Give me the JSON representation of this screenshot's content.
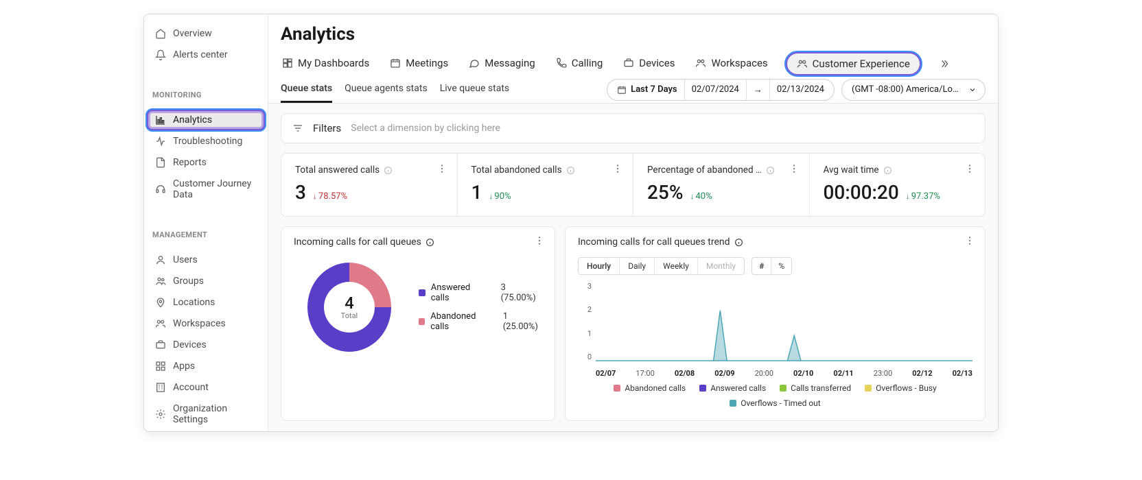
{
  "sidebar": {
    "top": [
      {
        "name": "overview",
        "label": "Overview"
      },
      {
        "name": "alerts-center",
        "label": "Alerts center"
      }
    ],
    "monitoring_label": "MONITORING",
    "monitoring": [
      {
        "name": "analytics",
        "label": "Analytics",
        "active": true
      },
      {
        "name": "troubleshooting",
        "label": "Troubleshooting"
      },
      {
        "name": "reports",
        "label": "Reports"
      },
      {
        "name": "customer-journey",
        "label": "Customer Journey Data"
      }
    ],
    "management_label": "MANAGEMENT",
    "management": [
      {
        "name": "users",
        "label": "Users"
      },
      {
        "name": "groups",
        "label": "Groups"
      },
      {
        "name": "locations",
        "label": "Locations"
      },
      {
        "name": "workspaces",
        "label": "Workspaces"
      },
      {
        "name": "devices",
        "label": "Devices"
      },
      {
        "name": "apps",
        "label": "Apps"
      },
      {
        "name": "account",
        "label": "Account"
      },
      {
        "name": "organization-settings",
        "label": "Organization Settings"
      }
    ]
  },
  "header": {
    "title": "Analytics",
    "tabs": [
      {
        "name": "my-dashboards",
        "label": "My Dashboards"
      },
      {
        "name": "meetings",
        "label": "Meetings"
      },
      {
        "name": "messaging",
        "label": "Messaging"
      },
      {
        "name": "calling",
        "label": "Calling"
      },
      {
        "name": "devices",
        "label": "Devices"
      },
      {
        "name": "workspaces",
        "label": "Workspaces"
      },
      {
        "name": "customer-experience",
        "label": "Customer Experience",
        "highlighted": true
      }
    ],
    "sub_tabs": [
      {
        "name": "queue-stats",
        "label": "Queue stats",
        "active": true
      },
      {
        "name": "queue-agents-stats",
        "label": "Queue agents stats"
      },
      {
        "name": "live-queue-stats",
        "label": "Live queue stats"
      }
    ],
    "date_range": {
      "preset": "Last 7 Days",
      "from": "02/07/2024",
      "to": "02/13/2024"
    },
    "timezone": "(GMT -08:00) America/Los …"
  },
  "filters": {
    "label": "Filters",
    "placeholder": "Select a dimension by clicking here"
  },
  "kpis": [
    {
      "name": "total-answered-calls",
      "title": "Total answered calls",
      "value": "3",
      "delta": "78.57%",
      "direction": "down",
      "color": "red"
    },
    {
      "name": "total-abandoned-calls",
      "title": "Total abandoned calls",
      "value": "1",
      "delta": "90%",
      "direction": "down",
      "color": "green"
    },
    {
      "name": "percentage-abandoned",
      "title": "Percentage of abandoned …",
      "value": "25%",
      "delta": "40%",
      "direction": "down",
      "color": "green"
    },
    {
      "name": "avg-wait-time",
      "title": "Avg wait time",
      "value": "00:00:20",
      "delta": "97.37%",
      "direction": "down",
      "color": "green"
    }
  ],
  "donut_card": {
    "title": "Incoming calls for call queues",
    "total_value": "4",
    "total_label": "Total",
    "legend": [
      {
        "color": "purple",
        "label": "Answered calls",
        "extra": "3 (75.00%)"
      },
      {
        "color": "pink",
        "label": "Abandoned calls",
        "extra": "1 (25.00%)"
      }
    ]
  },
  "trend_card": {
    "title": "Incoming calls for call queues trend",
    "segs_time": [
      "Hourly",
      "Daily",
      "Weekly",
      "Monthly"
    ],
    "segs_time_active": "Hourly",
    "segs_time_disabled": "Monthly",
    "segs_unit": [
      "#",
      "%"
    ],
    "segs_unit_active": "#",
    "y_ticks": [
      "3",
      "2",
      "1",
      "0"
    ],
    "x_ticks": [
      "02/07",
      "17:00",
      "02/08",
      "02/09",
      "20:00",
      "02/10",
      "02/11",
      "23:00",
      "02/12",
      "02/13"
    ],
    "x_bold": [
      "02/07",
      "02/08",
      "02/09",
      "02/10",
      "02/11",
      "02/12",
      "02/13"
    ],
    "legend": [
      {
        "color": "pink",
        "label": "Abandoned calls"
      },
      {
        "color": "purple",
        "label": "Answered calls"
      },
      {
        "color": "green",
        "label": "Calls transferred"
      },
      {
        "color": "yellow",
        "label": "Overflows - Busy"
      },
      {
        "color": "teal",
        "label": "Overflows - Timed out"
      }
    ]
  },
  "chart_data": [
    {
      "type": "pie",
      "title": "Incoming calls for call queues",
      "series": [
        {
          "name": "Answered calls",
          "value": 3,
          "percent": 75.0
        },
        {
          "name": "Abandoned calls",
          "value": 1,
          "percent": 25.0
        }
      ],
      "total": 4
    },
    {
      "type": "area",
      "title": "Incoming calls for call queues trend",
      "xlabel": "",
      "ylabel": "",
      "ylim": [
        0,
        3
      ],
      "x": [
        "02/07",
        "17:00",
        "02/08",
        "02/09",
        "20:00",
        "02/10",
        "02/11",
        "23:00",
        "02/12",
        "02/13"
      ],
      "series": [
        {
          "name": "Abandoned calls",
          "values": [
            0,
            0,
            0,
            0,
            0,
            0,
            0,
            0,
            0,
            0
          ]
        },
        {
          "name": "Answered calls",
          "values": [
            0,
            0,
            0,
            2,
            0,
            1,
            0,
            0,
            0,
            0
          ]
        },
        {
          "name": "Calls transferred",
          "values": [
            0,
            0,
            0,
            0,
            0,
            0,
            0,
            0,
            0,
            0
          ]
        },
        {
          "name": "Overflows - Busy",
          "values": [
            0,
            0,
            0,
            0,
            0,
            0,
            0,
            0,
            0,
            0
          ]
        },
        {
          "name": "Overflows - Timed out",
          "values": [
            0,
            0,
            0,
            0,
            0,
            0,
            0,
            0,
            0,
            0
          ]
        }
      ]
    }
  ]
}
